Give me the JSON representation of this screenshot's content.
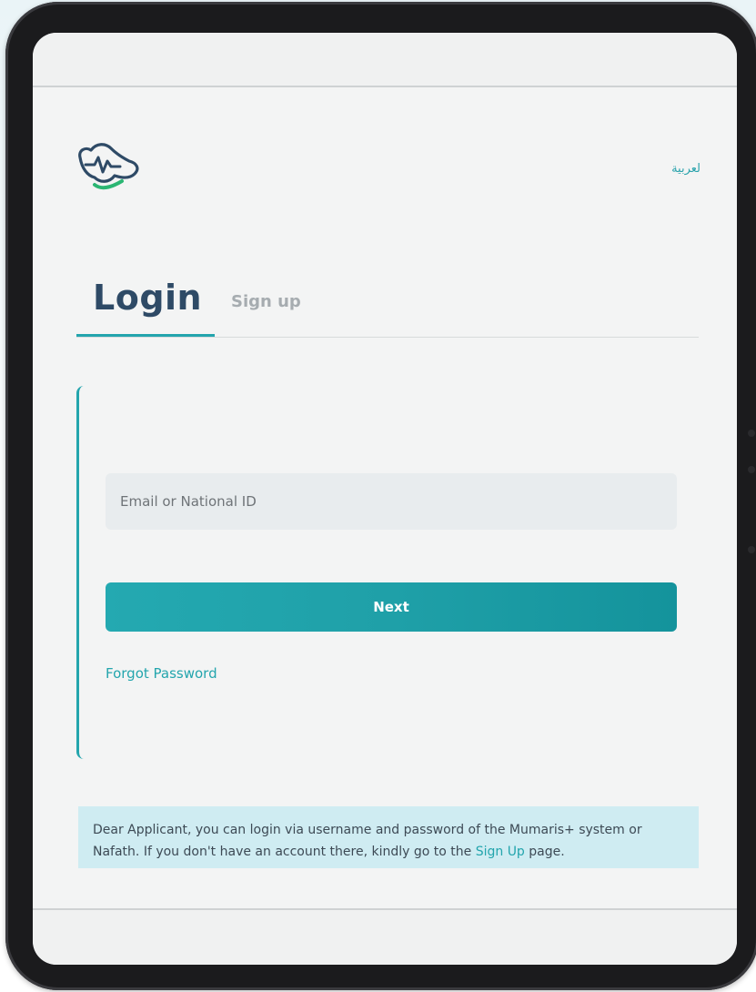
{
  "header": {
    "language_toggle": "لعربية"
  },
  "tabs": {
    "login": "Login",
    "signup": "Sign up"
  },
  "form": {
    "email": {
      "placeholder": "Email or National ID",
      "value": ""
    },
    "next_label": "Next",
    "forgot_label": "Forgot Password"
  },
  "notice": {
    "text_before": "Dear Applicant, you can login via username and password of the Mumaris+ system or Nafath. If you don't have an account there, kindly go to the ",
    "link": "Sign Up",
    "text_after": " page."
  },
  "colors": {
    "accent": "#23a5ad",
    "heading": "#2e4a66",
    "notice_bg": "#cfecf2",
    "logo_stroke": "#2e4a66",
    "logo_check": "#2bb673"
  },
  "icons": {
    "logo": "heartbeat-map-check-logo"
  }
}
